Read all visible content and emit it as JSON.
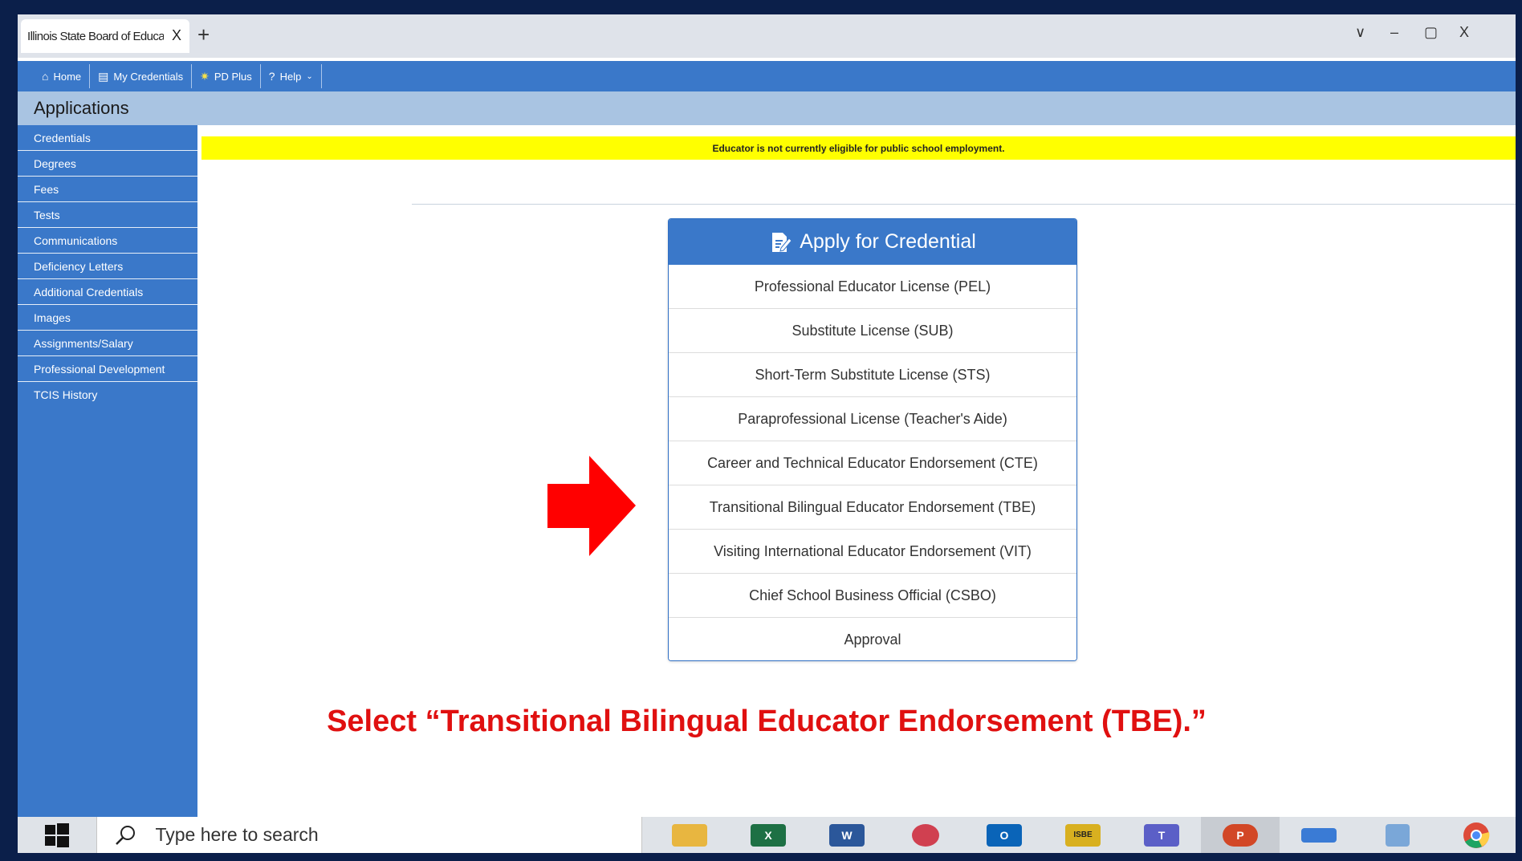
{
  "browser": {
    "tab_title": "Illinois State Board of Education",
    "tab_close": "X",
    "new_tab": "+",
    "controls": [
      "∨",
      "–",
      "▢",
      "X"
    ]
  },
  "navbar": {
    "items": [
      {
        "label": "Home",
        "icon": "home-icon"
      },
      {
        "label": "My Credentials",
        "icon": "credentials-icon"
      },
      {
        "label": "PD Plus",
        "icon": "pd-plus-icon"
      },
      {
        "label": "Help",
        "icon": "help-icon"
      }
    ]
  },
  "header": {
    "title": "Applications"
  },
  "sidebar": {
    "items": [
      "Credentials",
      "Degrees",
      "Fees",
      "Tests",
      "Communications",
      "Deficiency Letters",
      "Additional Credentials",
      "Images",
      "Assignments/Salary",
      "Professional Development",
      "TCIS History"
    ]
  },
  "alert": {
    "text": "Educator is not currently eligible for public school employment."
  },
  "panel": {
    "title": "Apply for Credential",
    "items": [
      "Professional Educator License (PEL)",
      "Substitute License (SUB)",
      "Short-Term Substitute License (STS)",
      "Paraprofessional License (Teacher's Aide)",
      "Career and Technical Educator Endorsement (CTE)",
      "Transitional Bilingual Educator Endorsement (TBE)",
      "Visiting International Educator Endorsement (VIT)",
      "Chief School Business Official (CSBO)",
      "Approval"
    ]
  },
  "instruction": {
    "text": "Select “Transitional Bilingual Educator Endorsement (TBE).”"
  },
  "taskbar": {
    "search_placeholder": "Type here to search",
    "icons": [
      {
        "name": "file-explorer-icon",
        "label": "",
        "color": "#e8b640"
      },
      {
        "name": "excel-icon",
        "label": "X",
        "color": "#1d7044"
      },
      {
        "name": "word-icon",
        "label": "W",
        "color": "#2b579a"
      },
      {
        "name": "snipping-tool-icon",
        "label": "",
        "color": "#d04050"
      },
      {
        "name": "outlook-icon",
        "label": "O",
        "color": "#0a64b8"
      },
      {
        "name": "isbe-icon",
        "label": "ISBE",
        "color": "#d8b020"
      },
      {
        "name": "teams-icon",
        "label": "T",
        "color": "#5b5fc7"
      },
      {
        "name": "powerpoint-icon",
        "label": "P",
        "color": "#d24726"
      },
      {
        "name": "laptop-icon",
        "label": "",
        "color": "#3a7bd5"
      },
      {
        "name": "calculator-icon",
        "label": "",
        "color": "#7aa7d8"
      },
      {
        "name": "chrome-icon",
        "label": "",
        "color": "#dd4b39"
      }
    ]
  },
  "colors": {
    "nav_blue": "#3a78c9",
    "header_band": "#a9c4e2",
    "alert_yellow": "#ffff00",
    "instruction_red": "#e01010",
    "arrow_red": "#ff0000"
  }
}
